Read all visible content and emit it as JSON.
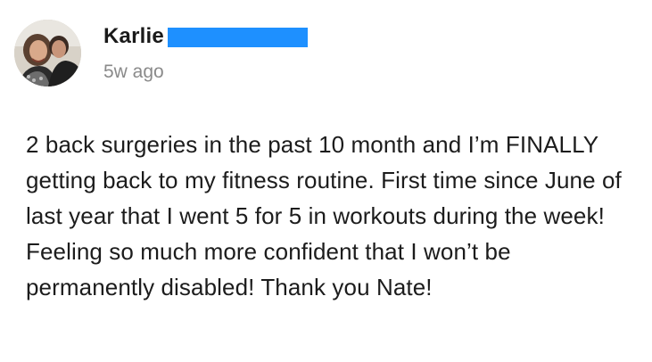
{
  "post": {
    "author_name": "Karlie",
    "timestamp": "5w ago",
    "body": "2 back surgeries in the past 10 month and I’m FINALLY getting back to my fitness routine. First time since June of last year that I went 5 for 5 in workouts during the week! Feeling so much more confident that I won’t be permanently disabled! Thank you Nate!",
    "redaction_color": "#1e90ff",
    "avatar_icon": "user-photo"
  }
}
